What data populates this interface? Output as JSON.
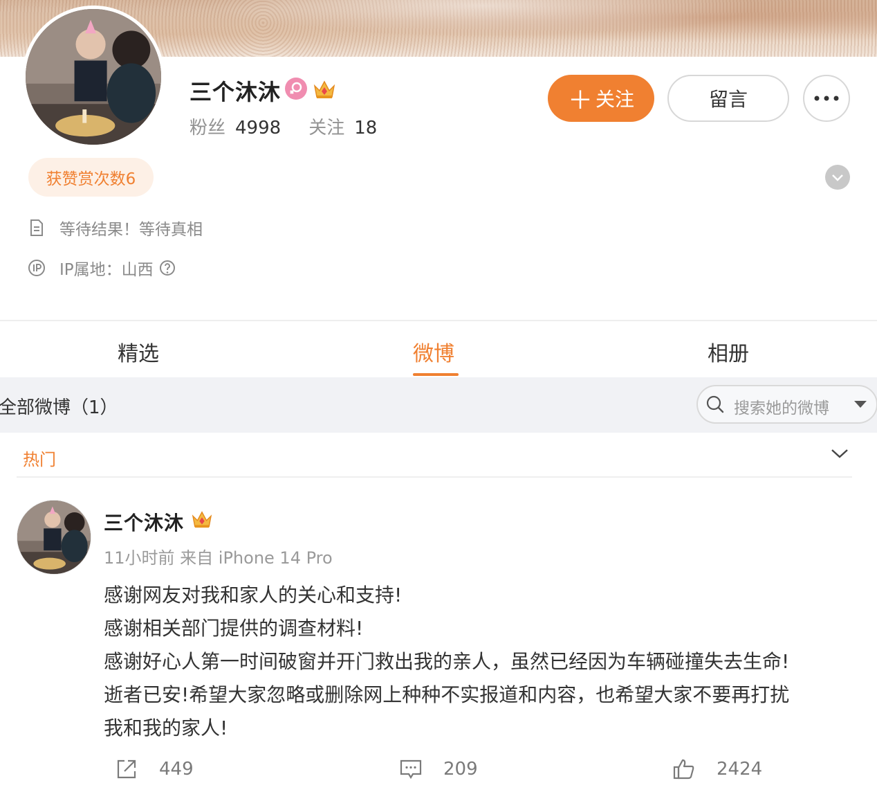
{
  "profile": {
    "name": "三个沐沐",
    "fans_label": "粉丝",
    "fans_count": "4998",
    "following_label": "关注",
    "following_count": "18",
    "follow_button": "关注",
    "message_button": "留言",
    "more_button": "•••",
    "reward_badge": "获赞赏次数6",
    "bio": "等待结果！等待真相",
    "ip_location": "IP属地：山西"
  },
  "tabs": [
    {
      "label": "精选",
      "active": false
    },
    {
      "label": "微博",
      "active": true
    },
    {
      "label": "相册",
      "active": false
    }
  ],
  "filter": {
    "title": "全部微博（1）",
    "search_placeholder": "搜索她的微博"
  },
  "section": {
    "hot_label": "热门"
  },
  "post": {
    "author": "三个沐沐",
    "meta": "11小时前  来自 iPhone 14 Pro",
    "lines": [
      "感谢网友对我和家人的关心和支持!",
      "感谢相关部门提供的调查材料!",
      "感谢好心人第一时间破窗并开门救出我的亲人，虽然已经因为车辆碰撞失去生命!",
      "逝者已安!希望大家忽略或删除网上种种不实报道和内容，也希望大家不要再打扰",
      "我和我的家人!"
    ],
    "reposts": "449",
    "comments": "209",
    "likes": "2424"
  },
  "icons": {
    "gender": "female-icon",
    "vip": "crown-icon",
    "bio": "document-icon",
    "ip": "ip-icon",
    "help": "question-icon",
    "expand": "chevron-down-icon",
    "search": "search-icon",
    "repost": "share-icon",
    "comment": "comment-icon",
    "like": "thumbs-up-icon"
  },
  "colors": {
    "accent": "#f08031",
    "female": "#f08db0",
    "text": "#333333",
    "muted": "#939393"
  }
}
